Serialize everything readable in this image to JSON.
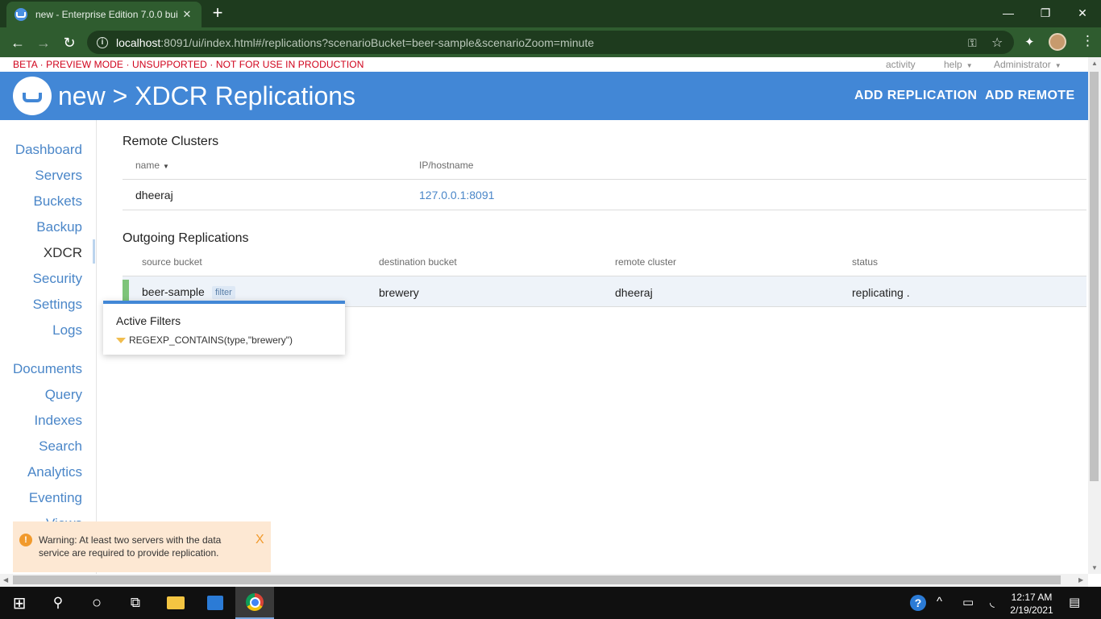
{
  "browser": {
    "tab_title": "new - Enterprise Edition 7.0.0 bui",
    "tab_close": "✕",
    "new_tab": "+",
    "url_host": "localhost",
    "url_rest": ":8091/ui/index.html#/replications?scenarioBucket=beer-sample&scenarioZoom=minute",
    "minimize": "—",
    "restore": "❐",
    "close": "✕",
    "back": "←",
    "forward": "→",
    "reload": "↻",
    "key_icon": "⚿",
    "star_icon": "☆",
    "extensions_icon": "✦",
    "menu_icon": "⋮",
    "info_glyph": "i"
  },
  "topbar": {
    "beta_notice": "BETA · PREVIEW MODE · UNSUPPORTED · NOT FOR USE IN PRODUCTION",
    "activity": "activity",
    "help": "help",
    "user": "Administrator",
    "caret": "▼"
  },
  "header": {
    "title": "new > XDCR Replications",
    "add_replication": "ADD REPLICATION",
    "add_remote": "ADD REMOTE"
  },
  "sidebar": {
    "items": [
      {
        "label": "Dashboard"
      },
      {
        "label": "Servers"
      },
      {
        "label": "Buckets"
      },
      {
        "label": "Backup"
      },
      {
        "label": "XDCR"
      },
      {
        "label": "Security"
      },
      {
        "label": "Settings"
      },
      {
        "label": "Logs"
      },
      {
        "label": "Documents"
      },
      {
        "label": "Query"
      },
      {
        "label": "Indexes"
      },
      {
        "label": "Search"
      },
      {
        "label": "Analytics"
      },
      {
        "label": "Eventing"
      },
      {
        "label": "Views"
      }
    ]
  },
  "remote_clusters": {
    "title": "Remote Clusters",
    "columns": [
      "name",
      "IP/hostname"
    ],
    "sort_caret": "▼",
    "rows": [
      {
        "name": "dheeraj",
        "host": "127.0.0.1:8091"
      }
    ]
  },
  "outgoing": {
    "title": "Outgoing Replications",
    "columns": [
      "source bucket",
      "destination bucket",
      "remote cluster",
      "status"
    ],
    "rows": [
      {
        "source": "beer-sample",
        "filter_badge": "filter",
        "destination": "brewery",
        "remote": "dheeraj",
        "status": "replicating ."
      }
    ]
  },
  "popover": {
    "title": "Active Filters",
    "filter_expr": "REGEXP_CONTAINS(type,\"brewery\")"
  },
  "warning": {
    "icon": "!",
    "text": "Warning: At least two servers with the data service are required to provide replication.",
    "close": "X"
  },
  "scrollbars": {
    "left_arrow": "◀",
    "right_arrow": "▶",
    "up_arrow": "▲",
    "down_arrow": "▼"
  },
  "taskbar": {
    "start_icon": "⊞",
    "search_icon": "⚲",
    "cortana_icon": "○",
    "taskview_icon": "⧉",
    "time": "12:17 AM",
    "date": "2/19/2021",
    "tray_help": "?",
    "tray_chevron": "^",
    "tray_battery": "▭",
    "tray_wifi": "◟",
    "tray_volume": "◁",
    "tray_notify": "▤"
  }
}
